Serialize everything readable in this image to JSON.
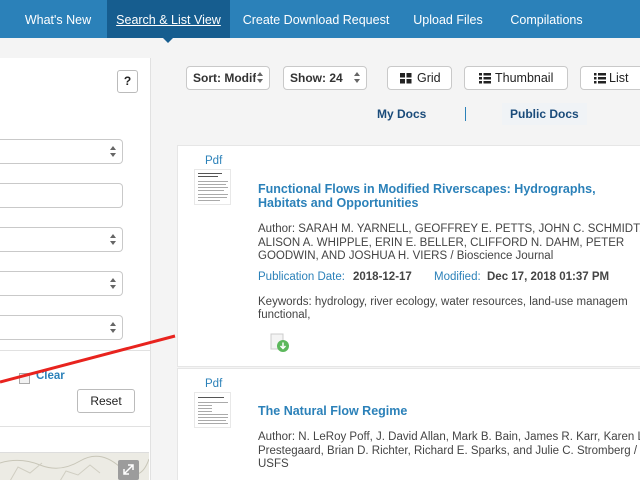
{
  "nav": {
    "items": [
      {
        "label": "What's New"
      },
      {
        "label": "Search & List View"
      },
      {
        "label": "Create Download Request"
      },
      {
        "label": "Upload Files"
      },
      {
        "label": "Compilations"
      }
    ],
    "active_index": 1
  },
  "left_panel": {
    "help_label": "?",
    "clear_label": "Clear",
    "reset_label": "Reset"
  },
  "toolbar": {
    "sort_value": "Sort: Modif",
    "show_value": "Show: 24",
    "grid_label": "Grid",
    "thumbnail_label": "Thumbnail",
    "list_label": "List"
  },
  "doc_tabs": {
    "my_docs": "My Docs",
    "separator": "|",
    "public_docs": "Public Docs"
  },
  "documents": [
    {
      "type_label": "Pdf",
      "title": "Functional Flows in Modified Riverscapes: Hydrographs, Habitats and Opportunities",
      "author_line": "Author: SARAH M. YARNELL, GEOFFREY E. PETTS, JOHN C. SCHMIDT, ALISON A. WHIPPLE, ERIN E. BELLER, CLIFFORD N. DAHM, PETER GOODWIN, AND JOSHUA H. VIERS / Bioscience Journal",
      "pub_date_label": "Publication Date:",
      "pub_date": "2018-12-17",
      "modified_label": "Modified:",
      "modified": "Dec 17, 2018 01:37 PM",
      "keywords_line1": "Keywords: hydrology, river ecology, water resources, land-use managem",
      "keywords_line2": "functional,"
    },
    {
      "type_label": "Pdf",
      "title": "The Natural Flow Regime",
      "author_line": "Author: N. LeRoy Poff, J. David Allan, Mark B. Bain, James R. Karr, Karen L. Prestegaard, Brian D. Richter, Richard E. Sparks, and Julie C. Stromberg / USFS"
    }
  ],
  "colors": {
    "nav_bg": "#2b81b9",
    "nav_active": "#165d8f",
    "link": "#2b81b9",
    "annotation_line": "#e8231e"
  },
  "icons": [
    "grid-icon",
    "thumbnail-icon",
    "list-icon",
    "download-icon",
    "expand-icon"
  ]
}
